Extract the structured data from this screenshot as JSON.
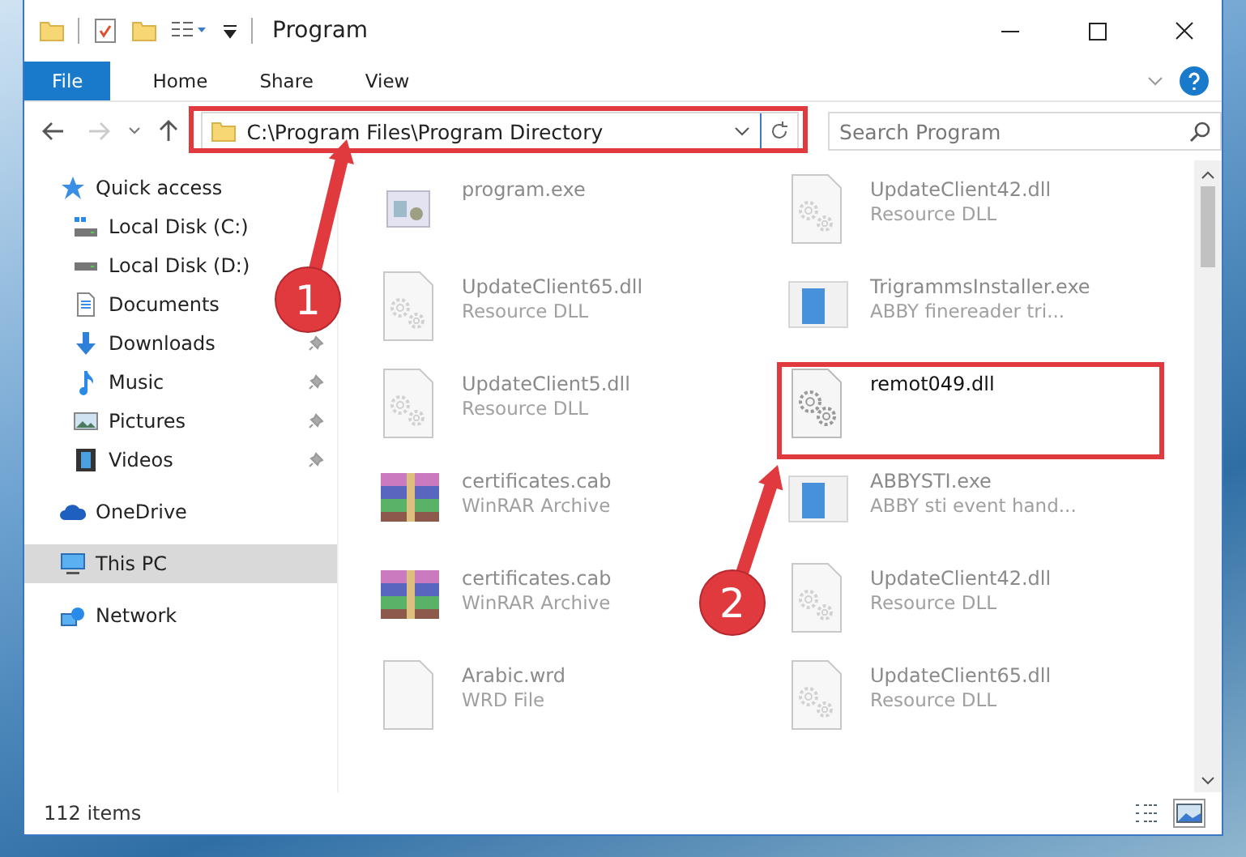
{
  "window": {
    "title": "Program"
  },
  "ribbon": {
    "tabs": [
      {
        "label": "File",
        "selected": true
      },
      {
        "label": "Home",
        "selected": false
      },
      {
        "label": "Share",
        "selected": false
      },
      {
        "label": "View",
        "selected": false
      }
    ]
  },
  "navigation": {
    "forward_disabled": true,
    "address": "C:\\Program Files\\Program Directory",
    "search": {
      "placeholder": "Search Program"
    }
  },
  "sidebar": {
    "items": [
      {
        "label": "Quick access",
        "kind": "star",
        "selected": false,
        "children": [
          {
            "label": "Local Disk (C:)",
            "kind": "system-drive",
            "pinned": false,
            "selected": false
          },
          {
            "label": "Local Disk (D:)",
            "kind": "drive",
            "pinned": false,
            "selected": false
          },
          {
            "label": "Documents",
            "kind": "documents",
            "pinned": false,
            "selected": false
          },
          {
            "label": "Downloads",
            "kind": "downloads",
            "pinned": true,
            "selected": false
          },
          {
            "label": "Music",
            "kind": "music",
            "pinned": true,
            "selected": false
          },
          {
            "label": "Pictures",
            "kind": "pictures",
            "pinned": true,
            "selected": false
          },
          {
            "label": "Videos",
            "kind": "videos",
            "pinned": true,
            "selected": false
          }
        ]
      },
      {
        "label": "OneDrive",
        "kind": "cloud",
        "selected": false
      },
      {
        "label": "This PC",
        "kind": "computer",
        "selected": true
      },
      {
        "label": "Network",
        "kind": "network",
        "selected": false
      }
    ]
  },
  "files": [
    {
      "name": "program.exe",
      "kind": "exe",
      "dimmed": true
    },
    {
      "name": "UpdateClient42.dll",
      "type": "Resource DLL",
      "kind": "dll",
      "dimmed": true
    },
    {
      "name": "UpdateClient65.dll",
      "type": "Resource DLL",
      "kind": "dll",
      "dimmed": true
    },
    {
      "name": "TrigrammsInstaller.exe",
      "type": "ABBY finereader tri...",
      "kind": "app",
      "dimmed": true
    },
    {
      "name": "UpdateClient5.dll",
      "type": "Resource DLL",
      "kind": "dll",
      "dimmed": true
    },
    {
      "name": "remot049.dll",
      "kind": "gears",
      "dimmed": false
    },
    {
      "name": "certificates.cab",
      "type": "WinRAR Archive",
      "kind": "archive",
      "dimmed": true
    },
    {
      "name": "ABBYSTI.exe",
      "type": "ABBY sti event hand...",
      "kind": "app",
      "dimmed": true
    },
    {
      "name": "certificates.cab",
      "type": "WinRAR Archive",
      "kind": "archive",
      "dimmed": true
    },
    {
      "name": "UpdateClient42.dll",
      "type": "Resource DLL",
      "kind": "dll",
      "dimmed": true
    },
    {
      "name": "Arabic.wrd",
      "type": "WRD File",
      "kind": "blank",
      "dimmed": true
    },
    {
      "name": "UpdateClient65.dll",
      "type": "Resource DLL",
      "kind": "dll",
      "dimmed": true
    }
  ],
  "status_bar": {
    "count": "112 items",
    "views": [
      {
        "kind": "details",
        "selected": false
      },
      {
        "kind": "large-icons",
        "selected": true
      }
    ]
  },
  "annotations": [
    {
      "label": "1"
    },
    {
      "label": "2"
    }
  ]
}
